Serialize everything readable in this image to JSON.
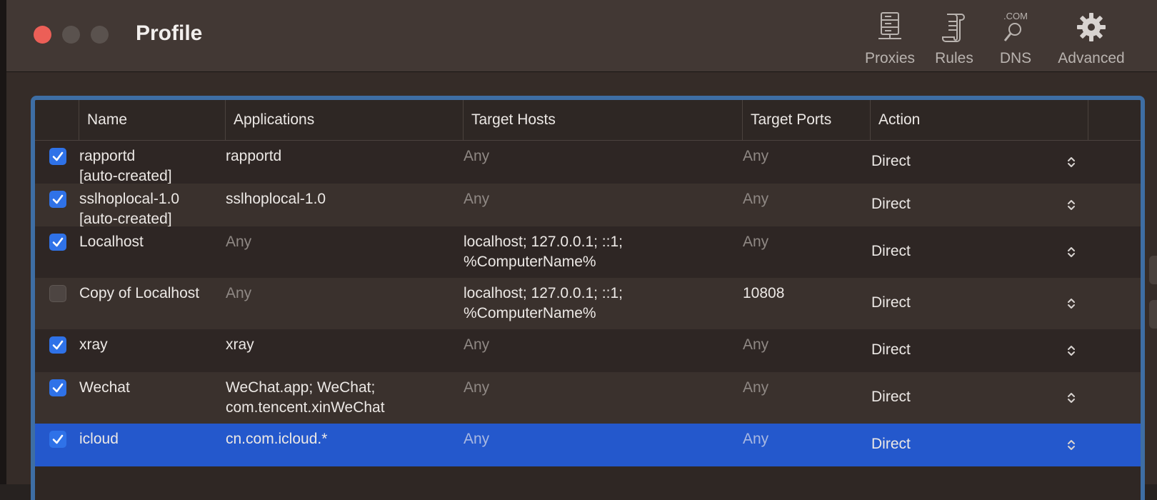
{
  "window": {
    "title": "Profile"
  },
  "toolbar": [
    {
      "label": "Proxies",
      "icon": "server-icon"
    },
    {
      "label": "Rules",
      "icon": "scroll-icon"
    },
    {
      "label": "DNS",
      "icon": "dns-icon",
      "badge": ".COM"
    },
    {
      "label": "Advanced",
      "icon": "gear-icon"
    }
  ],
  "table": {
    "columns": [
      "Name",
      "Applications",
      "Target Hosts",
      "Target Ports",
      "Action"
    ],
    "rows": [
      {
        "enabled": true,
        "name": "rapportd",
        "name2": "[auto-created]",
        "apps": "rapportd",
        "apps2": "",
        "hosts": "Any",
        "hosts2": "",
        "ports": "Any",
        "action": "Direct"
      },
      {
        "enabled": true,
        "name": "sslhoplocal-1.0",
        "name2": "[auto-created]",
        "apps": "sslhoplocal-1.0",
        "apps2": "",
        "hosts": "Any",
        "hosts2": "",
        "ports": "Any",
        "action": "Direct"
      },
      {
        "enabled": true,
        "name": "Localhost",
        "name2": "",
        "apps": "Any",
        "apps2": "",
        "hosts": "localhost; 127.0.0.1; ::1;",
        "hosts2": "%ComputerName%",
        "ports": "Any",
        "action": "Direct"
      },
      {
        "enabled": false,
        "name": "Copy of Localhost",
        "name2": "",
        "apps": "Any",
        "apps2": "",
        "hosts": "localhost; 127.0.0.1; ::1;",
        "hosts2": "%ComputerName%",
        "ports": "10808",
        "action": "Direct"
      },
      {
        "enabled": true,
        "name": "xray",
        "name2": "",
        "apps": "xray",
        "apps2": "",
        "hosts": "Any",
        "hosts2": "",
        "ports": "Any",
        "action": "Direct"
      },
      {
        "enabled": true,
        "name": "Wechat",
        "name2": "",
        "apps": "WeChat.app; WeChat;",
        "apps2": "com.tencent.xinWeChat",
        "hosts": "Any",
        "hosts2": "",
        "ports": "Any",
        "action": "Direct"
      },
      {
        "enabled": true,
        "name": "icloud",
        "name2": "",
        "apps": "cn.com.icloud.*",
        "apps2": "",
        "hosts": "Any",
        "hosts2": "",
        "ports": "Any",
        "action": "Direct",
        "selected": true
      }
    ]
  },
  "colors": {
    "accent": "#2f72e8",
    "selection": "#2458cc",
    "close": "#ec5f57",
    "focus_ring": "#3e6ea4"
  }
}
